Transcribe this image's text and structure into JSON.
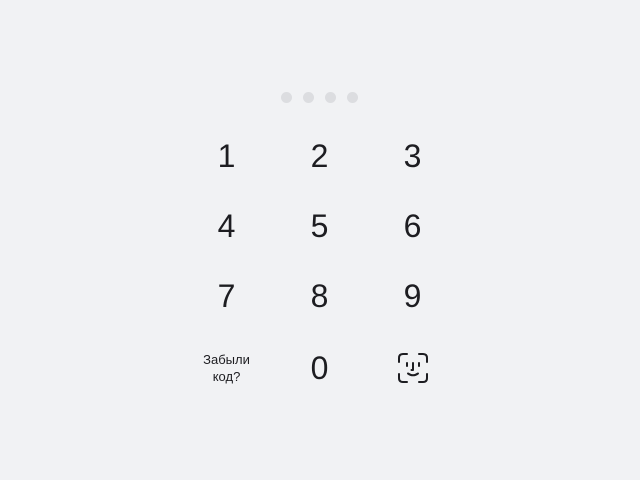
{
  "pin": {
    "length": 4,
    "entered": 0,
    "dot_color": "#dcdde0"
  },
  "keypad": {
    "keys": [
      "1",
      "2",
      "3",
      "4",
      "5",
      "6",
      "7",
      "8",
      "9"
    ],
    "zero": "0",
    "forgot_label": "Забыли\nкод?",
    "biometric_icon": "face-id-icon"
  },
  "colors": {
    "background": "#f1f2f4",
    "text": "#1d1d21"
  }
}
